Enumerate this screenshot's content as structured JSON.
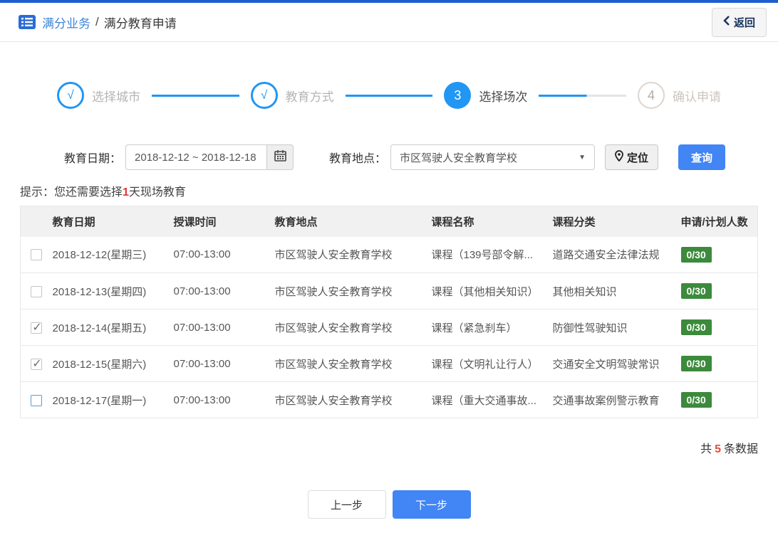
{
  "header": {
    "breadcrumb_root": "满分业务",
    "breadcrumb_sep": "/",
    "breadcrumb_current": "满分教育申请",
    "back_label": "返回"
  },
  "steps": [
    {
      "mark": "√",
      "label": "选择城市",
      "state": "done"
    },
    {
      "mark": "√",
      "label": "教育方式",
      "state": "done"
    },
    {
      "mark": "3",
      "label": "选择场次",
      "state": "active"
    },
    {
      "mark": "4",
      "label": "确认申请",
      "state": "pending"
    }
  ],
  "filters": {
    "date_label": "教育日期：",
    "date_value": "2018-12-12 ~ 2018-12-18",
    "location_label": "教育地点：",
    "location_value": "市区驾驶人安全教育学校",
    "locate_label": "定位",
    "search_label": "查询"
  },
  "hint": {
    "prefix": "提示：您还需要选择",
    "count": "1",
    "suffix": "天现场教育"
  },
  "table": {
    "headers": [
      "教育日期",
      "授课时间",
      "教育地点",
      "课程名称",
      "课程分类",
      "申请/计划人数"
    ],
    "rows": [
      {
        "checked": false,
        "highlighted": false,
        "date": "2018-12-12(星期三)",
        "time": "07:00-13:00",
        "location": "市区驾驶人安全教育学校",
        "course": "课程（139号部令解...",
        "category": "道路交通安全法律法规",
        "quota": "0/30"
      },
      {
        "checked": false,
        "highlighted": false,
        "date": "2018-12-13(星期四)",
        "time": "07:00-13:00",
        "location": "市区驾驶人安全教育学校",
        "course": "课程（其他相关知识）",
        "category": "其他相关知识",
        "quota": "0/30"
      },
      {
        "checked": true,
        "highlighted": false,
        "date": "2018-12-14(星期五)",
        "time": "07:00-13:00",
        "location": "市区驾驶人安全教育学校",
        "course": "课程（紧急刹车）",
        "category": "防御性驾驶知识",
        "quota": "0/30"
      },
      {
        "checked": true,
        "highlighted": false,
        "date": "2018-12-15(星期六)",
        "time": "07:00-13:00",
        "location": "市区驾驶人安全教育学校",
        "course": "课程（文明礼让行人）",
        "category": "交通安全文明驾驶常识",
        "quota": "0/30"
      },
      {
        "checked": false,
        "highlighted": true,
        "date": "2018-12-17(星期一)",
        "time": "07:00-13:00",
        "location": "市区驾驶人安全教育学校",
        "course": "课程（重大交通事故...",
        "category": "交通事故案例警示教育",
        "quota": "0/30"
      }
    ]
  },
  "summary": {
    "prefix": "共",
    "count": "5",
    "suffix": "条数据"
  },
  "footer": {
    "prev_label": "上一步",
    "next_label": "下一步"
  },
  "icons": {
    "breadcrumb": "list-icon",
    "date": "calendar-icon",
    "locate": "location-pin-icon",
    "select": "chevron-down-icon",
    "back": "chevron-left-icon"
  },
  "colors": {
    "top_bar_blue": "#1d5fd0",
    "breadcrumb_blue": "#3d85d8",
    "step_blue": "#2196f3",
    "button_blue": "#4285f4",
    "badge_green": "#3c8a3c",
    "alert_red": "#e53333",
    "count_red": "#e74c3c"
  }
}
